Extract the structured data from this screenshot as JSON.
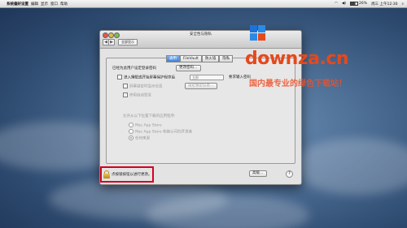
{
  "menubar": {
    "apple": "",
    "app": "系统偏好设置",
    "items": [
      "编辑",
      "显示",
      "窗口",
      "帮助"
    ],
    "right": {
      "battery": "26%",
      "clock": "周三 上午12:30"
    }
  },
  "window": {
    "title": "安全性与隐私",
    "back": "◀",
    "forward": "▶",
    "show_all": "全部显示",
    "tabs": [
      "通用",
      "FileVault",
      "防火墙",
      "隐私"
    ],
    "general": {
      "password_row": "已经为此用户设定登录密码",
      "change_password": "更改密码…",
      "require_password": "进入睡眠或开始屏幕保护程序后",
      "require_select": "立即",
      "require_password_suffix": "要求输入密码",
      "show_message": "屏幕锁定时显示信息",
      "set_lock_message": "设定锁定信息…",
      "disable_auto_login": "停用自动登录",
      "allow_apps_label": "允许从以下位置下载的应用程序:",
      "options": [
        "Mac App Store",
        "Mac App Store 和被认可的开发者",
        "任何来源"
      ],
      "selected": 2
    },
    "lock_text": "点按锁按钮以进行更改。",
    "advanced": "高级…",
    "help": "?"
  },
  "watermark": {
    "site": "downza.cn",
    "tagline": "国内最专业的绿色下载站！"
  }
}
